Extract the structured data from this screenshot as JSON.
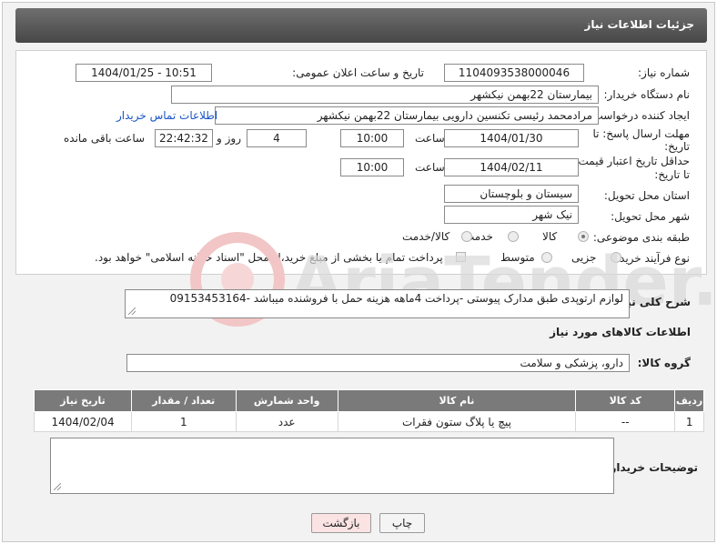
{
  "header": {
    "title": "جزئیات اطلاعات نیاز"
  },
  "form": {
    "need_number": {
      "label": "شماره نیاز:",
      "value": "1104093538000046"
    },
    "announce": {
      "label": "تاریخ و ساعت اعلان عمومی:",
      "value": "1404/01/25 - 10:51"
    },
    "buyer": {
      "label": "نام دستگاه خریدار:",
      "value": "بیمارستان 22بهمن نیکشهر"
    },
    "creator": {
      "label": "ایجاد کننده درخواست:",
      "value": "مرادمحمد رئیسی تکنسین دارویی بیمارستان 22بهمن نیکشهر",
      "contact_link": "اطلاعات تماس خریدار"
    },
    "deadline": {
      "label_line1": "مهلت ارسال پاسخ: تا",
      "label_line2": "تاریخ:",
      "date": "1404/01/30",
      "time_label": "ساعت",
      "time": "10:00",
      "days": "4",
      "days_label": "روز و",
      "remaining": "22:42:32",
      "remaining_label": "ساعت باقی مانده"
    },
    "validity": {
      "label_line1": "حداقل تاریخ اعتبار قیمت:",
      "label_line2": "تا تاریخ:",
      "date": "1404/02/11",
      "time_label": "ساعت",
      "time": "10:00"
    },
    "province": {
      "label": "استان محل تحویل:",
      "value": "سیستان و بلوچستان"
    },
    "city": {
      "label": "شهر محل تحویل:",
      "value": "نیک شهر"
    },
    "category": {
      "label": "طبقه بندی موضوعی:",
      "options": [
        "کالا",
        "خدمت",
        "کالا/خدمت"
      ]
    },
    "process": {
      "label": "نوع فرآیند خرید :",
      "options": [
        "جزیی",
        "متوسط"
      ],
      "payment_note": "پرداخت تمام یا بخشی از مبلغ خرید،از محل \"اسناد خزانه اسلامی\" خواهد بود."
    }
  },
  "description": {
    "label": "شرح کلی نیاز:",
    "value": "لوازم ارتوپدی طبق مدارک پیوستی -پرداخت 4ماهه هزینه حمل با فروشنده میباشد -09153453164"
  },
  "goods": {
    "section_title": "اطلاعات کالاهای مورد نیاز",
    "group_label": "گروه کالا:",
    "group_value": "دارو، پزشکی و سلامت",
    "columns": [
      "ردیف",
      "کد کالا",
      "نام کالا",
      "واحد شمارش",
      "تعداد / مقدار",
      "تاریخ نیاز"
    ],
    "rows": [
      [
        "1",
        "--",
        "پیچ یا پلاگ ستون فقرات",
        "عدد",
        "1",
        "1404/02/04"
      ]
    ]
  },
  "buyer_notes": {
    "label": "توضیحات خریدار:",
    "value": ""
  },
  "buttons": {
    "print": "چاپ",
    "back": "بازگشت"
  },
  "watermark": {
    "text": "AriaTender.net"
  }
}
